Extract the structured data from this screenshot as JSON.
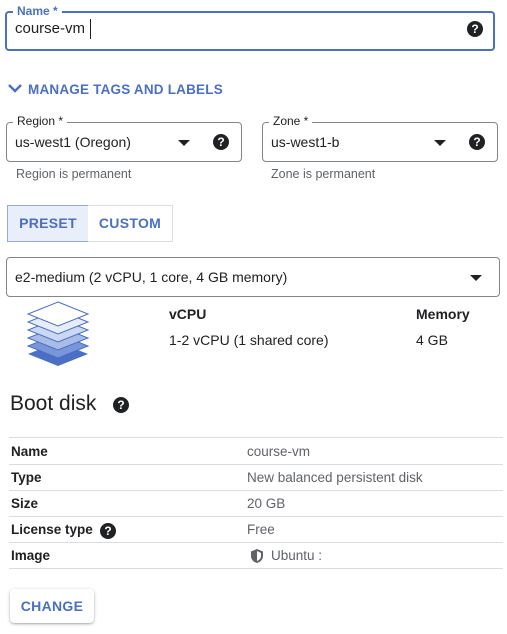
{
  "name_field": {
    "label": "Name *",
    "value": "course-vm",
    "help_icon": "help-icon"
  },
  "manage_tags": {
    "label": "MANAGE TAGS AND LABELS",
    "icon": "chevron-down-icon"
  },
  "region": {
    "label": "Region *",
    "value": "us-west1 (Oregon)",
    "hint": "Region is permanent"
  },
  "zone": {
    "label": "Zone *",
    "value": "us-west1-b",
    "hint": "Zone is permanent"
  },
  "machine_toggle": {
    "preset_label": "PRESET",
    "custom_label": "CUSTOM",
    "selected": "PRESET"
  },
  "machine_type": {
    "value": "e2-medium (2 vCPU, 1 core, 4 GB memory)",
    "vcpu_header": "vCPU",
    "vcpu_value": "1-2 vCPU (1 shared core)",
    "memory_header": "Memory",
    "memory_value": "4 GB",
    "icon": "layers-icon"
  },
  "boot_disk": {
    "title": "Boot disk",
    "rows": [
      {
        "key": "Name",
        "value": "course-vm"
      },
      {
        "key": "Type",
        "value": "New balanced persistent disk"
      },
      {
        "key": "Size",
        "value": "20 GB"
      },
      {
        "key": "License type",
        "value": "Free"
      },
      {
        "key": "Image",
        "value": "Ubuntu :"
      }
    ],
    "change_label": "CHANGE"
  },
  "colors": {
    "accent": "#4a6fc4",
    "selected_bg": "#e8eefa",
    "text": "#202124",
    "muted": "#5f6368"
  }
}
